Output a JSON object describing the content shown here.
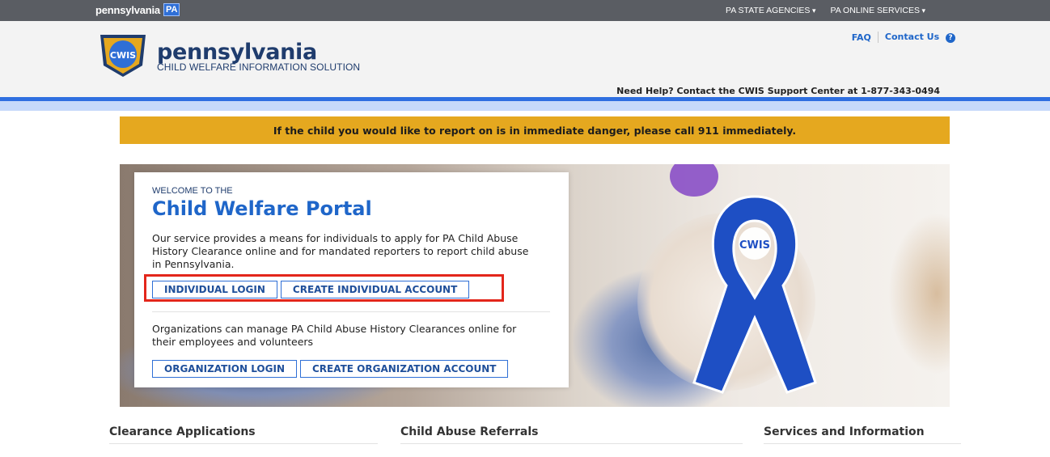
{
  "topbar": {
    "brand": "pennsylvania",
    "brand_badge": "PA",
    "menus": [
      "PA STATE AGENCIES",
      "PA ONLINE SERVICES"
    ]
  },
  "header": {
    "logo_badge": "CWIS",
    "title": "pennsylvania",
    "subtitle": "CHILD WELFARE INFORMATION SOLUTION",
    "faq": "FAQ",
    "contact": "Contact Us",
    "help": "Need Help? Contact the CWIS Support Center at 1-877-343-0494"
  },
  "alert": "If the child you would like to report on is in immediate danger, please call 911 immediately.",
  "welcome": {
    "eyebrow": "WELCOME TO THE",
    "title": "Child Welfare Portal",
    "description": "Our service provides a means for individuals to apply for PA Child Abuse History Clearance online and for mandated reporters to report child abuse in Pennsylvania.",
    "individual_login": "INDIVIDUAL LOGIN",
    "create_individual": "CREATE INDIVIDUAL ACCOUNT",
    "org_text": "Organizations can manage PA Child Abuse History Clearances online for their employees and volunteers",
    "org_login": "ORGANIZATION LOGIN",
    "create_org": "CREATE ORGANIZATION ACCOUNT"
  },
  "ribbon_badge": "CWIS",
  "sections": [
    "Clearance Applications",
    "Child Abuse Referrals",
    "Services and Information"
  ],
  "colors": {
    "topbar": "#5a5d63",
    "brand_blue": "#1f66c9",
    "navy": "#1f3c6d",
    "alert": "#e5a81f",
    "highlight": "#e3261b",
    "ribbon": "#1e4fc4"
  }
}
